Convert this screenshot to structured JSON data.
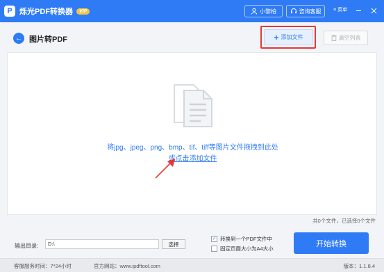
{
  "app": {
    "logo_letter": "P",
    "title": "烁光PDF转换器",
    "vip_badge": "VIP",
    "user_label": "小黎柏",
    "service_label": "咨询客服",
    "menu_label": "菜单"
  },
  "header": {
    "page_title": "图片转PDF",
    "add_file_label": "添加文件",
    "clear_list_label": "清空列表"
  },
  "dropzone": {
    "hint": "将jpg、jpeg、png、bmp、tif、tiff等图片文件拖拽到此处",
    "link_prefix": "或点击",
    "link_text": "添加文件"
  },
  "file_count": "共0个文件，已选择0个文件",
  "output": {
    "label": "输出目录:",
    "path": "D:\\",
    "select_label": "选择"
  },
  "options": [
    {
      "label": "转换到一个PDF文件中",
      "checked": true
    },
    {
      "label": "固定页面大小为A4大小",
      "checked": false
    }
  ],
  "start_label": "开始转换",
  "status": {
    "hours": "客服服务时间：7*24小时",
    "website": "官方网站：www.ipdftool.com",
    "version": "版本：1.1.8.4"
  },
  "colors": {
    "primary": "#2f7bf5",
    "vip": "#f6c344",
    "annotation": "#e53935"
  },
  "icons": {
    "user": "user-icon",
    "service": "headset-icon",
    "menu": "hamburger-icon",
    "back": "arrow-left-icon",
    "add": "plus-icon",
    "clear": "trash-icon",
    "documents": "documents-icon"
  }
}
